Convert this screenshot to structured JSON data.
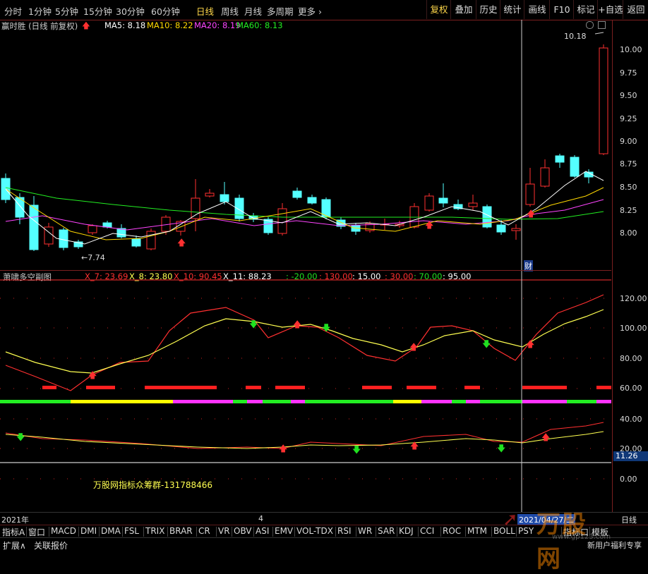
{
  "toolbar": {
    "periods": [
      "分时",
      "1分钟",
      "5分钟",
      "15分钟",
      "30分钟",
      "60分钟",
      "日线",
      "周线",
      "月线",
      "多周期",
      "更多"
    ],
    "active_period": "日线",
    "right_buttons": [
      "复权",
      "叠加",
      "历史",
      "统计",
      "画线",
      "F10",
      "标记",
      "+自选",
      "返回"
    ]
  },
  "main_chart": {
    "title": "赢时胜 (日线 前复权)",
    "ma": [
      {
        "label": "MA5: 8.18",
        "color": "#ffffff"
      },
      {
        "label": "MA10: 8.22",
        "color": "#ffd800"
      },
      {
        "label": "MA20: 8.19",
        "color": "#ff44ff"
      },
      {
        "label": "MA60: 8.13",
        "color": "#22ee22"
      }
    ],
    "high_label": "10.18",
    "low_label": "7.74",
    "cursor_label": "财",
    "price_ticks": [
      "10.00",
      "9.75",
      "9.50",
      "9.25",
      "9.00",
      "8.75",
      "8.50",
      "8.25",
      "8.00"
    ]
  },
  "sub_chart": {
    "title": "萧啸多空副图",
    "indicators": [
      {
        "label": "X_7: 23.69",
        "color": "#ff3030"
      },
      {
        "label": "X_8: 23.80",
        "color": "#ffff50"
      },
      {
        "label": "X_10: 90.45",
        "color": "#ff3030"
      },
      {
        "label": "X_11: 88.23",
        "color": "#ffffff"
      }
    ],
    "levels": [
      {
        "label": ": -20.00",
        "color": "#20e020"
      },
      {
        "label": ": 130.00",
        "color": "#ff3030"
      },
      {
        "label": ": 15.00",
        "color": "#ffffff"
      },
      {
        "label": ": 30.00",
        "color": "#ff3030"
      },
      {
        "label": ": 70.00",
        "color": "#20e020"
      },
      {
        "label": ": 95.00",
        "color": "#ffffff"
      }
    ],
    "ticks": [
      "120.00",
      "100.00",
      "80.00",
      "60.00",
      "40.00",
      "20.00",
      "0.00"
    ],
    "current_value": "11.26",
    "watermark_text": "万股网指标众筹群-131788466"
  },
  "date_bar": {
    "left": "2021年",
    "mid": "4",
    "cursor_date": "2021/04/27/二",
    "right": "日线"
  },
  "indicator_tabs": [
    "指标A",
    "窗口",
    "MACD",
    "DMI",
    "DMA",
    "FSL",
    "TRIX",
    "BRAR",
    "CR",
    "VR",
    "OBV",
    "ASI",
    "EMV",
    "VOL-TDX",
    "RSI",
    "WR",
    "SAR",
    "KDJ",
    "CCI",
    "ROC",
    "MTM",
    "BOLL",
    "PSY",
    "指标口",
    "模板"
  ],
  "bottom_bar": {
    "expand": "扩展∧",
    "quote": "关联报价",
    "promo": "新用户福利专享"
  },
  "logo": {
    "text": "万股网",
    "sub": "www.gp123.com"
  },
  "colors": {
    "up": "#ff3030",
    "down": "#54ffff",
    "bg": "#000000",
    "border": "#7a1f1f"
  }
}
